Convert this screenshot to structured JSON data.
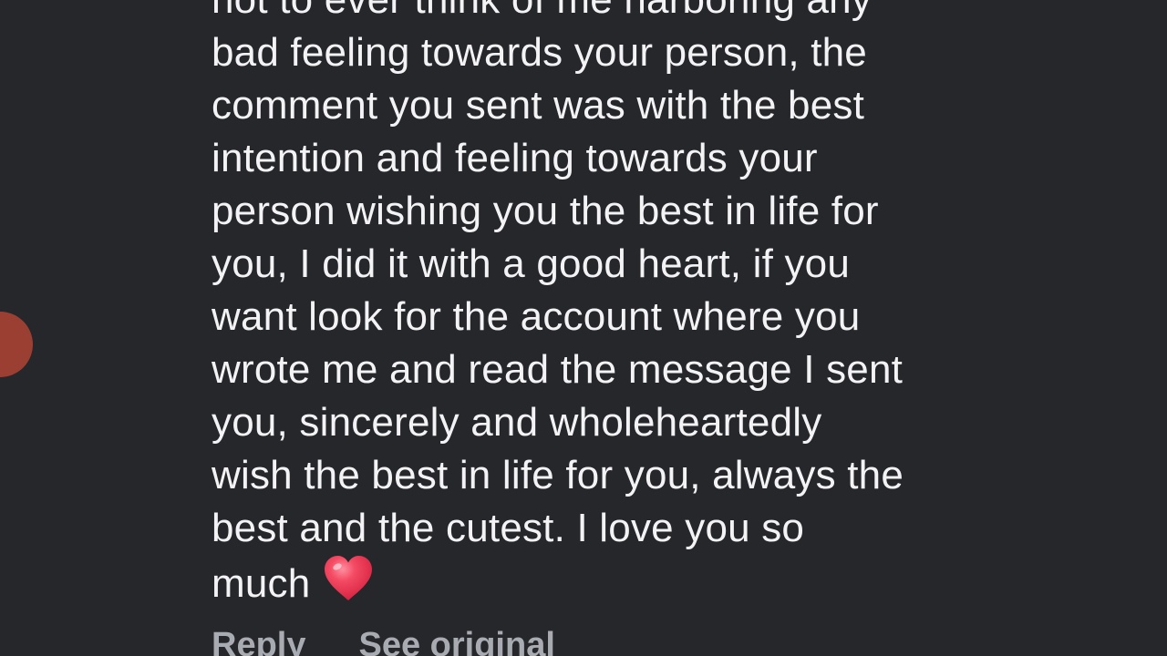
{
  "comment": {
    "lines": [
      "not to ever think of me harboring any",
      "bad feeling towards your person, the",
      "comment you sent was with the best",
      "intention and feeling towards your",
      "person wishing you the best in life for",
      "you, I did it with a good heart, if you",
      "want look for the account where you",
      "wrote me and read the message I sent",
      "you, sincerely and wholeheartedly",
      "wish the best in life for you, always the",
      "best and the cutest. I love you so",
      "much"
    ],
    "trailing_icon": "red-heart-icon"
  },
  "actions": {
    "reply_label": "Reply",
    "see_original_label": "See original"
  },
  "colors": {
    "background": "#26272b",
    "text": "#f3f3f5",
    "action_text": "#a9abb2",
    "avatar": "#9c3f33",
    "heart": "#f0394f"
  }
}
